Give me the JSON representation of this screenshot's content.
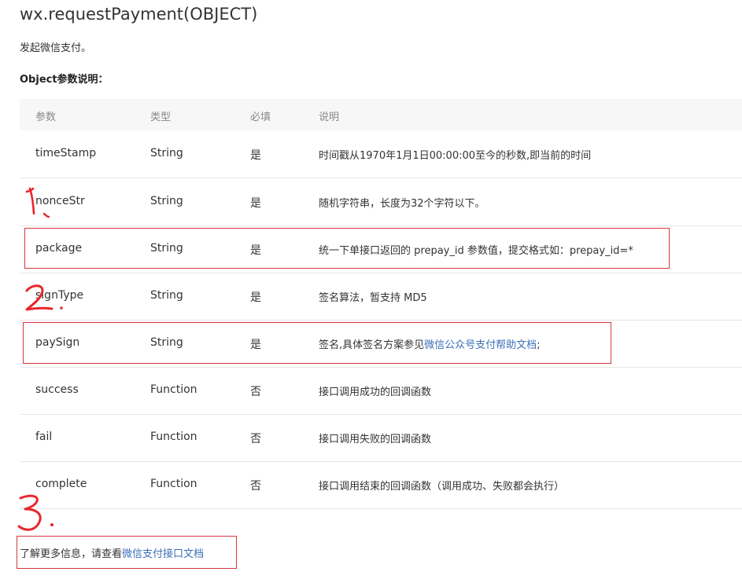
{
  "page": {
    "title": "wx.requestPayment(OBJECT)",
    "description": "发起微信支付。",
    "subheading": "Object参数说明："
  },
  "table": {
    "headers": [
      "参数",
      "类型",
      "必填",
      "说明"
    ],
    "rows": [
      {
        "name": "timeStamp",
        "type": "String",
        "required": "是",
        "desc": "时间戳从1970年1月1日00:00:00至今的秒数,即当前的时间"
      },
      {
        "name": "nonceStr",
        "type": "String",
        "required": "是",
        "desc": "随机字符串，长度为32个字符以下。"
      },
      {
        "name": "package",
        "type": "String",
        "required": "是",
        "desc": "统一下单接口返回的 prepay_id 参数值，提交格式如：prepay_id=*"
      },
      {
        "name": "signType",
        "type": "String",
        "required": "是",
        "desc": "签名算法，暂支持 MD5"
      },
      {
        "name": "paySign",
        "type": "String",
        "required": "是",
        "desc_prefix": "签名,具体签名方案参见",
        "desc_link": "微信公众号支付帮助文档",
        "desc_suffix": ";"
      },
      {
        "name": "success",
        "type": "Function",
        "required": "否",
        "desc": "接口调用成功的回调函数"
      },
      {
        "name": "fail",
        "type": "Function",
        "required": "否",
        "desc": "接口调用失败的回调函数"
      },
      {
        "name": "complete",
        "type": "Function",
        "required": "否",
        "desc": "接口调用结束的回调函数（调用成功、失败都会执行）"
      }
    ]
  },
  "footer": {
    "prefix": "了解更多信息，请查看",
    "link": "微信支付接口文档"
  },
  "annotations": {
    "color": "#e8262b",
    "marks": [
      "1.",
      "2.",
      "3."
    ]
  }
}
